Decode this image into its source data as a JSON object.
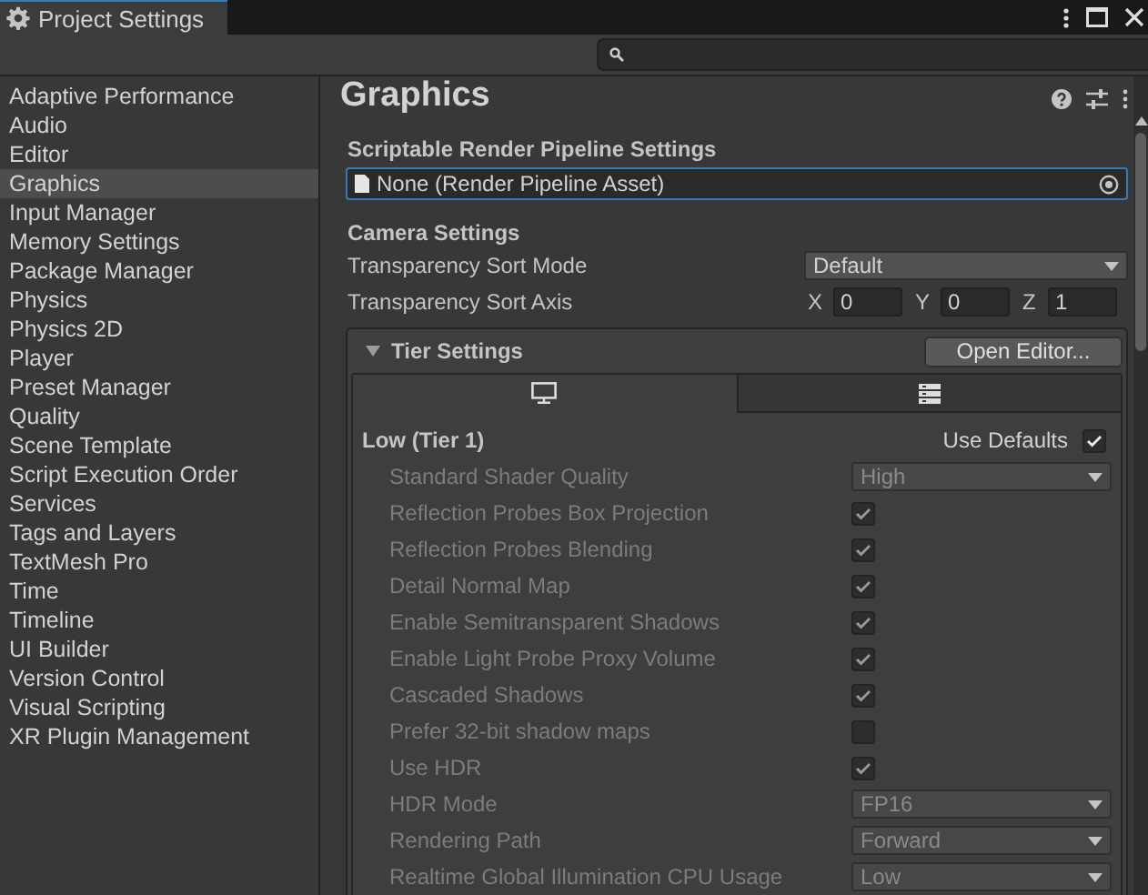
{
  "window": {
    "title": "Project Settings"
  },
  "sidebar": {
    "items": [
      {
        "label": "Adaptive Performance",
        "selected": false
      },
      {
        "label": "Audio",
        "selected": false
      },
      {
        "label": "Editor",
        "selected": false
      },
      {
        "label": "Graphics",
        "selected": true
      },
      {
        "label": "Input Manager",
        "selected": false
      },
      {
        "label": "Memory Settings",
        "selected": false
      },
      {
        "label": "Package Manager",
        "selected": false
      },
      {
        "label": "Physics",
        "selected": false
      },
      {
        "label": "Physics 2D",
        "selected": false
      },
      {
        "label": "Player",
        "selected": false
      },
      {
        "label": "Preset Manager",
        "selected": false
      },
      {
        "label": "Quality",
        "selected": false
      },
      {
        "label": "Scene Template",
        "selected": false
      },
      {
        "label": "Script Execution Order",
        "selected": false
      },
      {
        "label": "Services",
        "selected": false
      },
      {
        "label": "Tags and Layers",
        "selected": false
      },
      {
        "label": "TextMesh Pro",
        "selected": false
      },
      {
        "label": "Time",
        "selected": false
      },
      {
        "label": "Timeline",
        "selected": false
      },
      {
        "label": "UI Builder",
        "selected": false
      },
      {
        "label": "Version Control",
        "selected": false
      },
      {
        "label": "Visual Scripting",
        "selected": false
      },
      {
        "label": "XR Plugin Management",
        "selected": false
      }
    ]
  },
  "page": {
    "title": "Graphics",
    "srp": {
      "heading": "Scriptable Render Pipeline Settings",
      "value": "None (Render Pipeline Asset)"
    },
    "camera": {
      "heading": "Camera Settings",
      "sort_mode_label": "Transparency Sort Mode",
      "sort_mode": "Default",
      "sort_axis_label": "Transparency Sort Axis",
      "axis": [
        {
          "label": "X",
          "value": "0"
        },
        {
          "label": "Y",
          "value": "0"
        },
        {
          "label": "Z",
          "value": "1"
        }
      ]
    },
    "tier_settings": {
      "heading": "Tier Settings",
      "expanded": true,
      "open_editor": "Open Editor...",
      "tabs": [
        {
          "kind": "monitor",
          "selected": true
        },
        {
          "kind": "server",
          "selected": false
        }
      ],
      "tier": {
        "title": "Low (Tier 1)",
        "use_defaults_label": "Use Defaults",
        "use_defaults": true,
        "rows": [
          {
            "kind": "dropdown",
            "label": "Standard Shader Quality",
            "value": "High"
          },
          {
            "kind": "checkbox",
            "label": "Reflection Probes Box Projection",
            "checked": true
          },
          {
            "kind": "checkbox",
            "label": "Reflection Probes Blending",
            "checked": true
          },
          {
            "kind": "checkbox",
            "label": "Detail Normal Map",
            "checked": true
          },
          {
            "kind": "checkbox",
            "label": "Enable Semitransparent Shadows",
            "checked": true
          },
          {
            "kind": "checkbox",
            "label": "Enable Light Probe Proxy Volume",
            "checked": true
          },
          {
            "kind": "checkbox",
            "label": "Cascaded Shadows",
            "checked": true
          },
          {
            "kind": "checkbox",
            "label": "Prefer 32-bit shadow maps",
            "checked": false
          },
          {
            "kind": "checkbox",
            "label": "Use HDR",
            "checked": true
          },
          {
            "kind": "dropdown",
            "label": "HDR Mode",
            "value": "FP16"
          },
          {
            "kind": "dropdown",
            "label": "Rendering Path",
            "value": "Forward"
          },
          {
            "kind": "dropdown",
            "label": "Realtime Global Illumination CPU Usage",
            "value": "Low"
          }
        ]
      }
    }
  }
}
